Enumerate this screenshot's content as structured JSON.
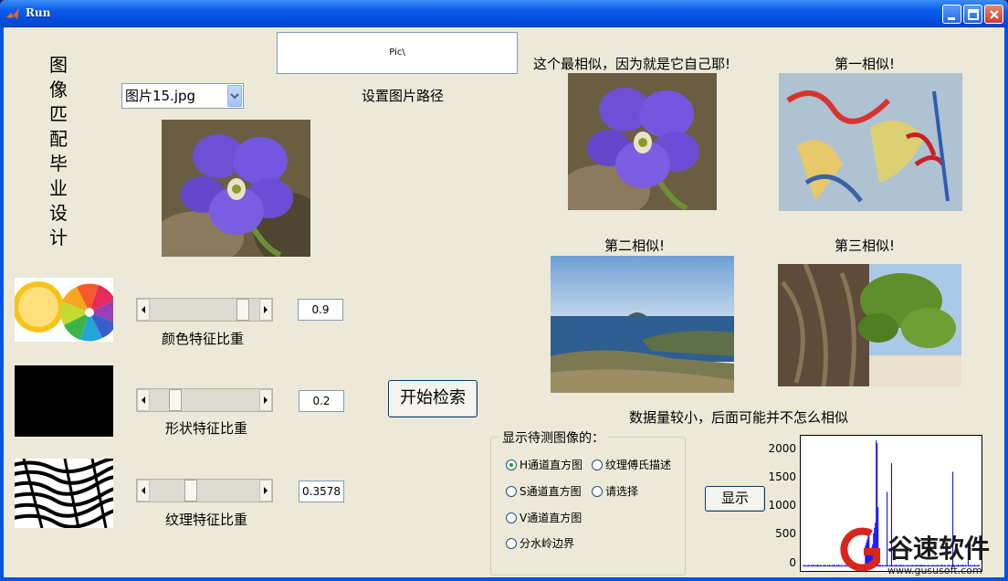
{
  "window": {
    "title": "Run"
  },
  "app_title_vertical": "图像匹配毕业设计",
  "path_box": {
    "value": "Pic\\"
  },
  "path_label": "设置图片路径",
  "image_select": {
    "selected": "图片15.jpg"
  },
  "sliders": [
    {
      "label": "颜色特征比重",
      "value": "0.9",
      "level": 0.9
    },
    {
      "label": "形状特征比重",
      "value": "0.2",
      "level": 0.2
    },
    {
      "label": "纹理特征比重",
      "value": "0.3578",
      "level": 0.3578
    }
  ],
  "search_button": "开始检索",
  "results": {
    "best_caption": "这个最相似，因为就是它自己耶!",
    "first_caption": "第一相似!",
    "second_caption": "第二相似!",
    "third_caption": "第三相似!",
    "note": "数据量较小，后面可能并不怎么相似"
  },
  "display_group": {
    "title": "显示待测图像的：",
    "options": [
      "H通道直方图",
      "S通道直方图",
      "V通道直方图",
      "分水岭边界",
      "纹理傅氏描述",
      "请选择"
    ],
    "selected": "H通道直方图"
  },
  "show_button": "显示",
  "histogram": {
    "yticks": [
      "2000",
      "1500",
      "1000",
      "500",
      "0"
    ],
    "ylim": [
      0,
      2200
    ]
  },
  "watermark": {
    "brand": "谷速软件",
    "url": "www.gususoft.com"
  },
  "colors": {
    "titlebar": "#0054e3",
    "face": "#ece9d8",
    "histogram_bar": "#0000ff"
  }
}
